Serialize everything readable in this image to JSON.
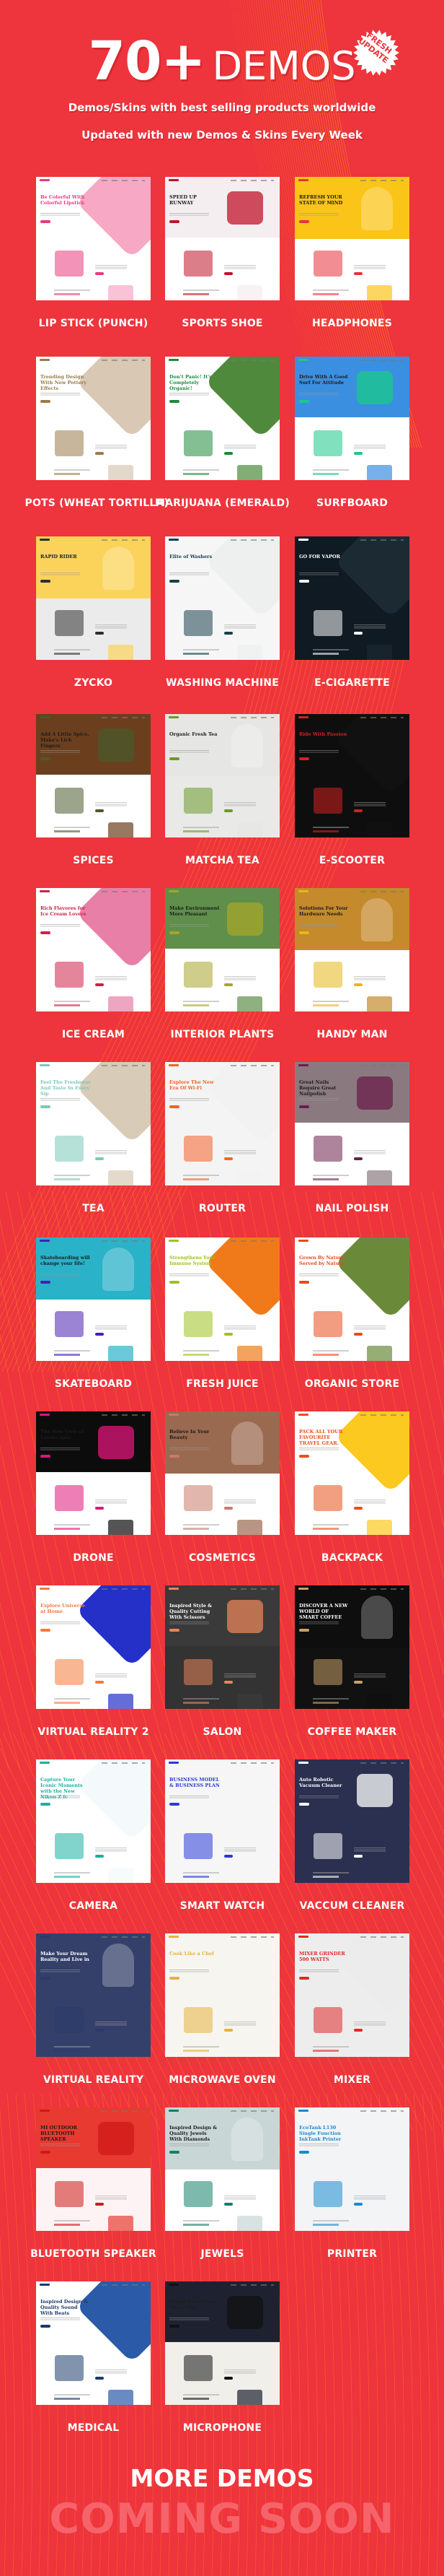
{
  "header": {
    "count": "70+",
    "word": "DEMOS",
    "badge": [
      "FRESH",
      "UPDATE"
    ],
    "subtitle_1": "Demos/Skins with best selling products worldwide",
    "subtitle_2": "Updated with new Demos & Skins Every Week"
  },
  "colors": {
    "background": "#ee343c",
    "accent_lines": "#ff9f1a",
    "coming_soon": "#f6636b",
    "text": "#ffffff"
  },
  "demos": [
    {
      "label": "LIP STICK (PUNCH)",
      "headline": "Be Colorful With Colorful Lipstick",
      "accent": "#e83a7c",
      "hero": "#f7a8c4",
      "bg": "#ffffff",
      "dark": false
    },
    {
      "label": "SPORTS SHOE",
      "headline": "SPEED UP RUNWAY",
      "accent": "#c0142a",
      "hero": "#f4eef1",
      "bg": "#ffffff",
      "dark": false
    },
    {
      "label": "HEADPHONES",
      "headline": "REFRESH YOUR STATE OF MIND",
      "accent": "#e8323a",
      "hero": "#fbc419",
      "bg": "#ffffff",
      "dark": false
    },
    {
      "label": "POTS (WHEAT TORTILLA)",
      "headline": "Trending Design With New Pottery Effects",
      "accent": "#9b7a4b",
      "hero": "#d9c8b4",
      "bg": "#ffffff",
      "dark": false
    },
    {
      "label": "MARIJUANA (EMERALD)",
      "headline": "Don't Panic! It's Completely Organic!",
      "accent": "#1e8a3a",
      "hero": "#4f8a3c",
      "bg": "#ffffff",
      "dark": false
    },
    {
      "label": "SURFBOARD",
      "headline": "Drive With A Good Surf For Attitude",
      "accent": "#19c98a",
      "hero": "#3a8fe0",
      "bg": "#ffffff",
      "dark": false
    },
    {
      "label": "ZYCKO",
      "headline": "RAPID RIDER",
      "accent": "#2d2d2d",
      "hero": "#fbd35a",
      "bg": "#ebebeb",
      "dark": false
    },
    {
      "label": "WASHING MACHINE",
      "headline": "Elite of Washers",
      "accent": "#17404a",
      "hero": "#eef0f0",
      "bg": "#f6f6f6",
      "dark": false
    },
    {
      "label": "E-CIGARETTE",
      "headline": "GO FOR VAPOR",
      "accent": "#ffffff",
      "hero": "#1b2a33",
      "bg": "#0f1a22",
      "dark": true
    },
    {
      "label": "SPICES",
      "headline": "Add A Little Spice, Make's Lick Fingers",
      "accent": "#4a5a2c",
      "hero": "#6b3f1e",
      "bg": "#ffffff",
      "dark": false
    },
    {
      "label": "MATCHA TEA",
      "headline": "Organic Fresh Tea",
      "accent": "#6a9a2a",
      "hero": "#e6e6e4",
      "bg": "#e9e9e7",
      "dark": false
    },
    {
      "label": "E-SCOOTER",
      "headline": "Ride With Passion",
      "accent": "#d42020",
      "hero": "#111111",
      "bg": "#0e0e0e",
      "dark": true
    },
    {
      "label": "ICE CREAM",
      "headline": "Rich Flavores for Ice Cream Lovers",
      "accent": "#d0204a",
      "hero": "#e77fa6",
      "bg": "#ffffff",
      "dark": false
    },
    {
      "label": "INTERIOR PLANTS",
      "headline": "Make Environment More Pleasant",
      "accent": "#a5a62a",
      "hero": "#5f8f4a",
      "bg": "#ffffff",
      "dark": false
    },
    {
      "label": "HANDY MAN",
      "headline": "Solutions For Your Hardware Needs",
      "accent": "#e8b61a",
      "hero": "#c48a2c",
      "bg": "#ffffff",
      "dark": false
    },
    {
      "label": "TEA",
      "headline": "Feel The Freshness And Taste In Every Sip",
      "accent": "#7ac9b8",
      "hero": "#d8cbb7",
      "bg": "#ffffff",
      "dark": false
    },
    {
      "label": "ROUTER",
      "headline": "Explore The New Era Of Wi-Fi",
      "accent": "#f4622a",
      "hero": "#f2f2f2",
      "bg": "#f4f4f4",
      "dark": false
    },
    {
      "label": "NAIL POLISH",
      "headline": "Great Nails Require Great Nailpolish",
      "accent": "#6a1f4a",
      "hero": "#8a7a80",
      "bg": "#ffffff",
      "dark": false
    },
    {
      "label": "SKATEBOARD",
      "headline": "Skateboarding will change your life!",
      "accent": "#4a1fb0",
      "hero": "#2ab2c8",
      "bg": "#ffffff",
      "dark": false
    },
    {
      "label": "FRESH JUICE",
      "headline": "Strengthens Your Immune System",
      "accent": "#9cc21f",
      "hero": "#f07a1a",
      "bg": "#ffffff",
      "dark": false
    },
    {
      "label": "ORGANIC STORE",
      "headline": "Grown By Nature- Served by Nature",
      "accent": "#e84a1a",
      "hero": "#6a8a3a",
      "bg": "#ffffff",
      "dark": false
    },
    {
      "label": "DRONE",
      "headline": "The New View of Landscapes",
      "accent": "#e0157a",
      "hero": "#0c0c0c",
      "bg": "#ffffff",
      "dark": false
    },
    {
      "label": "COSMETICS",
      "headline": "Believe In Your Beauty",
      "accent": "#c97a6a",
      "hero": "#9a6a50",
      "bg": "#ffffff",
      "dark": false
    },
    {
      "label": "BACKPACK",
      "headline": "PACK ALL YOUR FAVOURITE TRAVEL GEAR.",
      "accent": "#e8501a",
      "hero": "#fbc91f",
      "bg": "#ffffff",
      "dark": false
    },
    {
      "label": "VIRTUAL REALITY 2",
      "headline": "Explore Universe at Home",
      "accent": "#f47a3a",
      "hero": "#2430c8",
      "bg": "#ffffff",
      "dark": false
    },
    {
      "label": "SALON",
      "headline": "Inspired Style & Quality Cutting With Scissors",
      "accent": "#e8845a",
      "hero": "#3a3a3a",
      "bg": "#333333",
      "dark": true
    },
    {
      "label": "COFFEE MAKER",
      "headline": "DISCOVER A NEW WORLD OF SMART COFFEE",
      "accent": "#c8a06a",
      "hero": "#0e0e0e",
      "bg": "#111111",
      "dark": true
    },
    {
      "label": "CAMERA",
      "headline": "Capture Your Iconic Moments with the New Nikon Z fc",
      "accent": "#1ab0a0",
      "hero": "#f4fafb",
      "bg": "#ffffff",
      "dark": false
    },
    {
      "label": "SMART WATCH",
      "headline": "BUSINESS MODEL & BUSINESS PLAN",
      "accent": "#2a3ad8",
      "hero": "#f6f6f6",
      "bg": "#f6f6f6",
      "dark": false
    },
    {
      "label": "VACCUM CLEANER",
      "headline": "Auto Robotic Vacuum Cleaner",
      "accent": "#ffffff",
      "hero": "#2b3050",
      "bg": "#2b3050",
      "dark": true
    },
    {
      "label": "VIRTUAL REALITY",
      "headline": "Make Your Dream Reality and Live in",
      "accent": "#2b3a6a",
      "hero": "#34406a",
      "bg": "#34406a",
      "dark": true
    },
    {
      "label": "MICROWAVE OVEN",
      "headline": "Cook Like a Chef",
      "accent": "#e8b040",
      "hero": "#f6f5ef",
      "bg": "#f6f5ef",
      "dark": false
    },
    {
      "label": "MIXER",
      "headline": "MIXER GRINDER 500 WATTS",
      "accent": "#e02828",
      "hero": "#ececec",
      "bg": "#ededed",
      "dark": false
    },
    {
      "label": "BLUETOOTH SPEAKER",
      "headline": "MI OUTDOOR BLUETOOTH SPEAKER",
      "accent": "#d01818",
      "hero": "#e83a30",
      "bg": "#fdf3f4",
      "dark": false
    },
    {
      "label": "JEWELS",
      "headline": "Inspired Design & Quality Jewels With Diamonds",
      "accent": "#12806a",
      "hero": "#c9d6d6",
      "bg": "#ffffff",
      "dark": false
    },
    {
      "label": "PRINTER",
      "headline": "EcoTank L130 Single Function InkTank Printer",
      "accent": "#1a8ad0",
      "hero": "#f2f4f6",
      "bg": "#f2f4f6",
      "dark": false
    },
    {
      "label": "MEDICAL",
      "headline": "Inspired Design & Quality Sound With Beats",
      "accent": "#1a3a6a",
      "hero": "#2a5aa8",
      "bg": "#ffffff",
      "dark": false
    },
    {
      "label": "MICROPHONE",
      "headline": "Sound Your Voice Like a Pro",
      "accent": "#111111",
      "hero": "#1e2230",
      "bg": "#f0efea",
      "dark": false
    }
  ],
  "footer": {
    "more": "MORE DEMOS",
    "soon": "COMING SOON"
  }
}
